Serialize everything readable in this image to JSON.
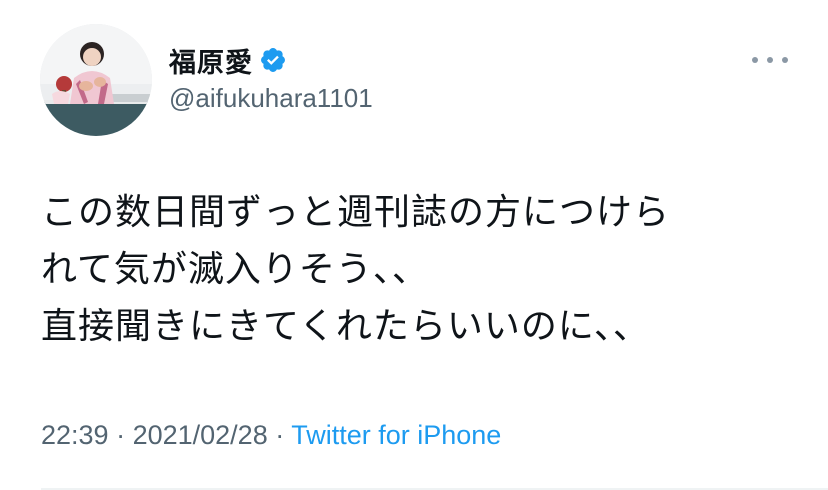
{
  "tweet": {
    "display_name": "福原愛",
    "handle": "@aifukuhara1101",
    "text_lines": [
      "この数日間ずっと週刊誌の方につけら",
      "れて気が滅入りそう、、",
      "直接聞きにきてくれたらいいのに、、"
    ],
    "time": "22:39",
    "separator": " · ",
    "date": "2021/02/28",
    "source": "Twitter for iPhone"
  },
  "icons": {
    "verified": "verified-badge-icon",
    "more": "more-options-icon"
  },
  "colors": {
    "accent": "#1d9bf0",
    "text_primary": "#0f1419",
    "text_secondary": "#536471"
  }
}
